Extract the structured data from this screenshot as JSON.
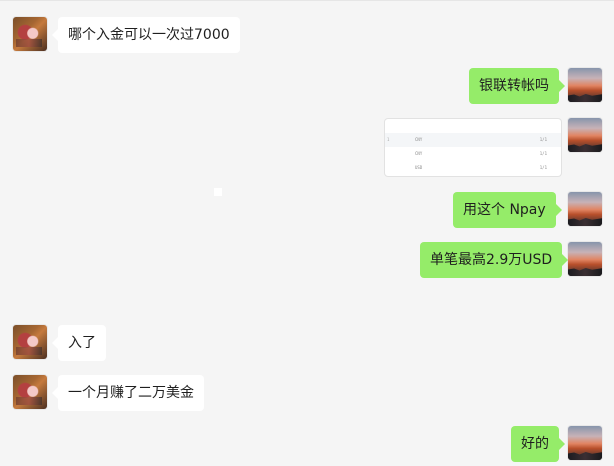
{
  "messages": [
    {
      "side": "left",
      "text": "哪个入金可以一次过7000"
    },
    {
      "side": "right",
      "text": "银联转帐吗"
    },
    {
      "side": "right",
      "type": "image",
      "rows": [
        {
          "tick": "",
          "left": "",
          "right": ""
        },
        {
          "tick": "1",
          "left": "CNY",
          "right": "1/1"
        },
        {
          "tick": "",
          "left": "CNY",
          "right": "1/1"
        },
        {
          "tick": "",
          "left": "USD",
          "right": "1/1"
        }
      ]
    },
    {
      "side": "right",
      "text": "用这个  Npay"
    },
    {
      "side": "right",
      "text": "单笔最高2.9万USD"
    },
    {
      "side": "left",
      "text": "入了"
    },
    {
      "side": "left",
      "text": "一个月赚了二万美金"
    },
    {
      "side": "right",
      "text": "好的"
    }
  ]
}
